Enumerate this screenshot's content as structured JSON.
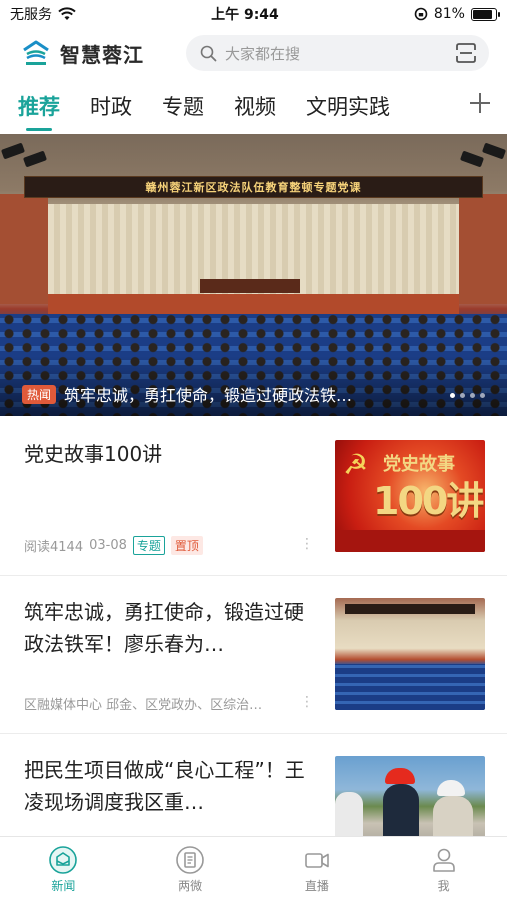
{
  "status_bar": {
    "carrier": "无服务",
    "time": "上午 9:44",
    "battery": "81%",
    "battery_level": 0.81
  },
  "header": {
    "app_name": "智慧蓉江",
    "search_placeholder": "大家都在搜"
  },
  "tabs": [
    {
      "label": "推荐",
      "active": true
    },
    {
      "label": "时政",
      "active": false
    },
    {
      "label": "专题",
      "active": false
    },
    {
      "label": "视频",
      "active": false
    },
    {
      "label": "文明实践",
      "active": false
    }
  ],
  "banner": {
    "tag": "热闻",
    "title": "筑牢忠诚，勇扛使命，锻造过硬政法铁…",
    "image_text": "赣州蓉江新区政法队伍教育整顿专题党课",
    "dots": 4,
    "active_dot": 1
  },
  "thumbs": {
    "party_main": "100讲",
    "party_sub": "党史故事"
  },
  "articles": [
    {
      "title": "党史故事100讲",
      "reads": "阅读4144",
      "date": "03-08",
      "tag_topic": "专题",
      "tag_pinned": "置顶"
    },
    {
      "title": "筑牢忠诚，勇扛使命，锻造过硬政法铁军！廖乐春为…",
      "source": "区融媒体中心 邱金、区党政办、区综治…"
    },
    {
      "title": "把民生项目做成“良心工程”！王凌现场调度我区重…"
    }
  ],
  "bottom_nav": [
    {
      "label": "新闻",
      "active": true
    },
    {
      "label": "两微",
      "active": false
    },
    {
      "label": "直播",
      "active": false
    },
    {
      "label": "我",
      "active": false
    }
  ],
  "colors": {
    "accent": "#1aa39a",
    "hot": "#e05a3a"
  },
  "icons": {
    "search": "search-icon",
    "scan": "scan-icon",
    "add": "plus-icon",
    "more": "more-dots-icon",
    "news": "news-icon",
    "weibo": "two-micro-icon",
    "live": "video-camera-icon",
    "me": "person-icon"
  }
}
